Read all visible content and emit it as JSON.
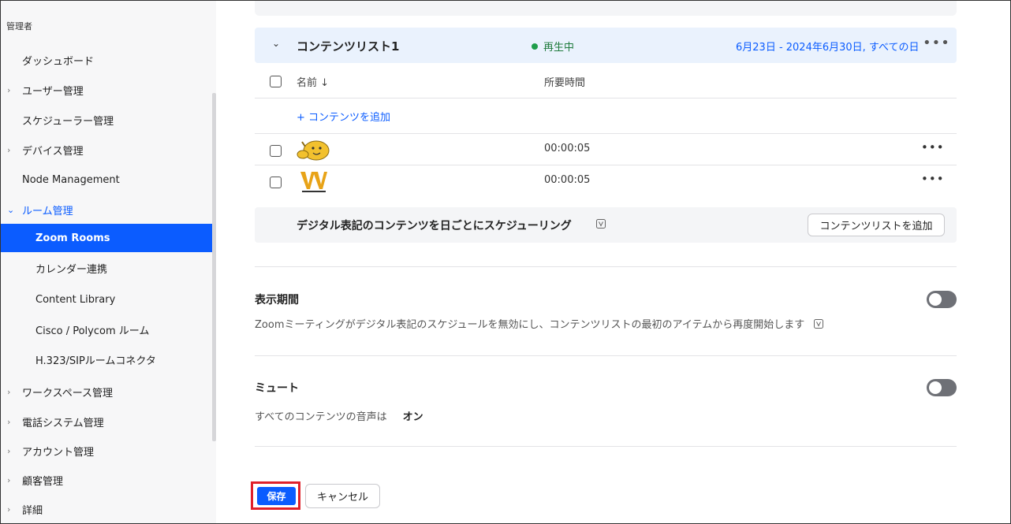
{
  "sidebar": {
    "header": "管理者",
    "items": [
      {
        "label": "ダッシュボード",
        "chevron": ""
      },
      {
        "label": "ユーザー管理",
        "chevron": "›"
      },
      {
        "label": "スケジューラー管理",
        "chevron": ""
      },
      {
        "label": "デバイス管理",
        "chevron": "›"
      },
      {
        "label": "Node Management",
        "chevron": ""
      },
      {
        "label": "ルーム管理",
        "chevron": "⌄"
      },
      {
        "label": "Zoom Rooms",
        "chevron": ""
      },
      {
        "label": "カレンダー連携",
        "chevron": ""
      },
      {
        "label": "Content Library",
        "chevron": ""
      },
      {
        "label": "Cisco / Polycom ルーム",
        "chevron": ""
      },
      {
        "label": "H.323/SIPルームコネクタ",
        "chevron": ""
      },
      {
        "label": "ワークスペース管理",
        "chevron": "›"
      },
      {
        "label": "電話システム管理",
        "chevron": "›"
      },
      {
        "label": "アカウント管理",
        "chevron": "›"
      },
      {
        "label": "顧客管理",
        "chevron": "›"
      },
      {
        "label": "詳細",
        "chevron": "›"
      }
    ]
  },
  "content_list": {
    "title": "コンテンツリスト1",
    "status": "再生中",
    "date_range": "6月23日 - 2024年6月30日, すべての日",
    "more": "•••",
    "columns": {
      "name": "名前 ↓",
      "duration": "所要時間"
    },
    "add_content": "+ コンテンツを追加",
    "rows": [
      {
        "duration": "00:00:05",
        "more": "•••"
      },
      {
        "duration": "00:00:05",
        "more": "•••"
      }
    ]
  },
  "schedule": {
    "text": "デジタル表記のコンテンツを日ごとにスケジューリング",
    "button": "コンテンツリストを追加"
  },
  "display_period": {
    "title": "表示期間",
    "description": "Zoomミーティングがデジタル表記のスケジュールを無効にし、コンテンツリストの最初のアイテムから再度開始します",
    "enabled": false
  },
  "mute": {
    "title": "ミュート",
    "description": "すべてのコンテンツの音声は",
    "value": "オン",
    "enabled": false
  },
  "actions": {
    "save": "保存",
    "cancel": "キャンセル"
  },
  "colors": {
    "accent": "#0b5cff",
    "status_green": "#1f9d4b",
    "highlight_red": "#e0202a"
  }
}
